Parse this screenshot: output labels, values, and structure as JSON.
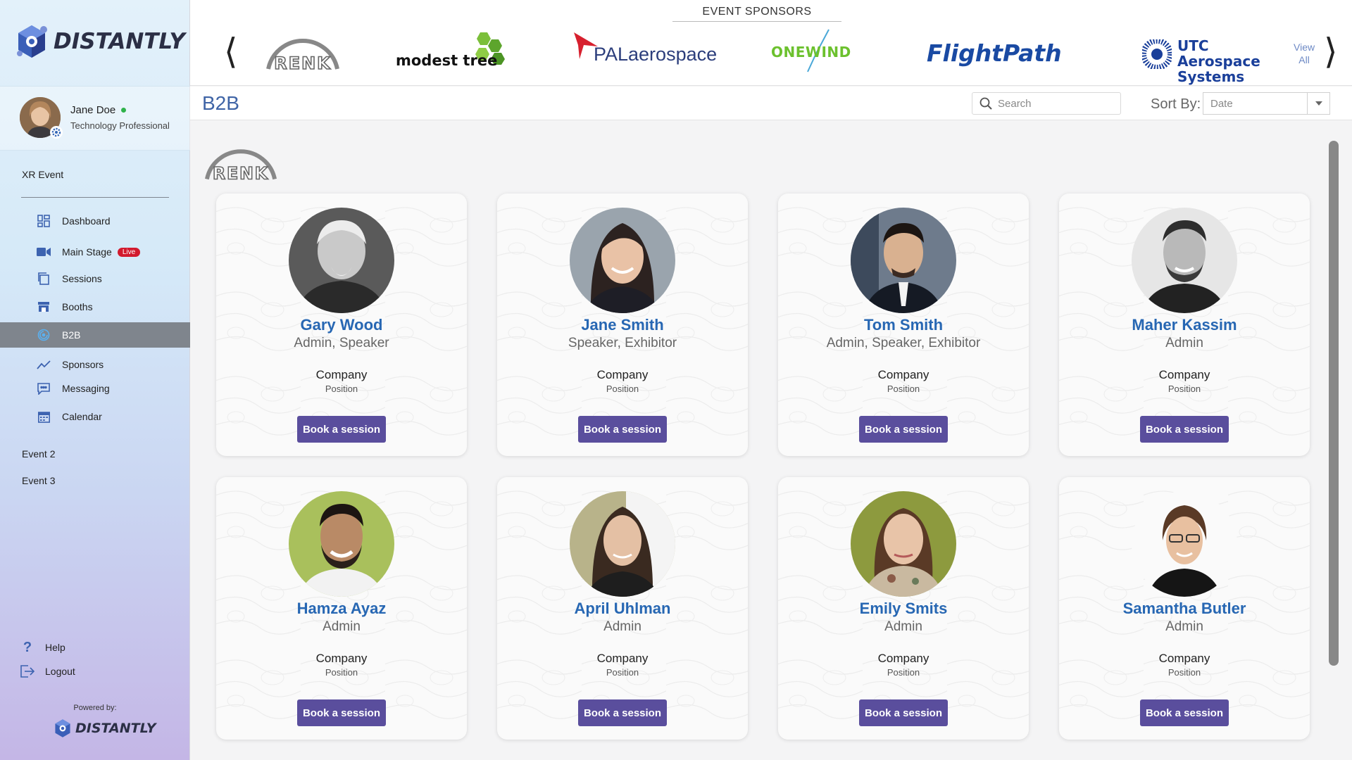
{
  "app": {
    "brand": "DISTANTLY"
  },
  "user": {
    "name": "Jane Doe",
    "title": "Technology Professional"
  },
  "sidebar": {
    "event_title": "XR Event",
    "items": [
      {
        "label": "Dashboard",
        "icon": "dashboard-icon"
      },
      {
        "label": "Main Stage",
        "icon": "video-camera-icon",
        "badge": "Live"
      },
      {
        "label": "Sessions",
        "icon": "sessions-icon"
      },
      {
        "label": "Booths",
        "icon": "booth-icon"
      },
      {
        "label": "B2B",
        "icon": "b2b-icon",
        "active": true
      },
      {
        "label": "Sponsors",
        "icon": "trend-icon"
      },
      {
        "label": "Messaging",
        "icon": "message-icon"
      },
      {
        "label": "Calendar",
        "icon": "calendar-icon"
      }
    ],
    "other_events": [
      "Event 2",
      "Event 3"
    ],
    "help": "Help",
    "logout": "Logout",
    "powered_by": "Powered by:"
  },
  "sponsors": {
    "title": "EVENT SPONSORS",
    "logos": [
      "RENK",
      "modest tree",
      "PALaerospace",
      "ONEWIND",
      "FlightPath",
      "UTC Aerospace Systems"
    ],
    "view_all": [
      "View",
      "All"
    ]
  },
  "header": {
    "title": "B2B",
    "search_placeholder": "Search",
    "sort_label": "Sort By:",
    "sort_value": "Date"
  },
  "company_logo": "RENK",
  "colors": {
    "accent": "#2767b3",
    "button": "#5a4e9d",
    "live": "#d21a2e",
    "active_nav": "#7f858d"
  },
  "cards": [
    {
      "name": "Gary Wood",
      "roles": "Admin, Speaker",
      "company": "Company",
      "position": "Position",
      "button": "Book a session"
    },
    {
      "name": "Jane Smith",
      "roles": "Speaker, Exhibitor",
      "company": "Company",
      "position": "Position",
      "button": "Book a session"
    },
    {
      "name": "Tom Smith",
      "roles": "Admin, Speaker, Exhibitor",
      "company": "Company",
      "position": "Position",
      "button": "Book a session"
    },
    {
      "name": "Maher Kassim",
      "roles": "Admin",
      "company": "Company",
      "position": "Position",
      "button": "Book a session"
    },
    {
      "name": "Hamza Ayaz",
      "roles": "Admin",
      "company": "Company",
      "position": "Position",
      "button": "Book a session"
    },
    {
      "name": "April Uhlman",
      "roles": "Admin",
      "company": "Company",
      "position": "Position",
      "button": "Book a session"
    },
    {
      "name": "Emily Smits",
      "roles": "Admin",
      "company": "Company",
      "position": "Position",
      "button": "Book a session"
    },
    {
      "name": "Samantha Butler",
      "roles": "Admin",
      "company": "Company",
      "position": "Position",
      "button": "Book a session"
    }
  ]
}
